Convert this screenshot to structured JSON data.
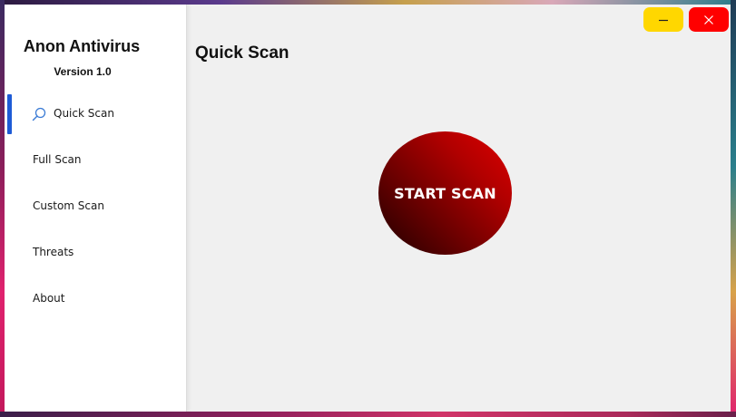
{
  "app": {
    "title": "Anon Antivirus",
    "version": "Version 1.0"
  },
  "sidebar": {
    "items": [
      {
        "label": "Quick Scan",
        "active": true,
        "icon": "search-icon"
      },
      {
        "label": "Full Scan",
        "active": false
      },
      {
        "label": "Custom Scan",
        "active": false
      },
      {
        "label": "Threats",
        "active": false
      },
      {
        "label": "About",
        "active": false
      }
    ]
  },
  "main": {
    "title": "Quick Scan",
    "scan_button_label": "START SCAN"
  },
  "window_controls": {
    "minimize_icon": "minimize-icon",
    "close_icon": "close-icon"
  },
  "colors": {
    "accent": "#1e5bd6",
    "minimize": "#ffd700",
    "close": "#ff0000",
    "scan_button": "#c00000"
  }
}
